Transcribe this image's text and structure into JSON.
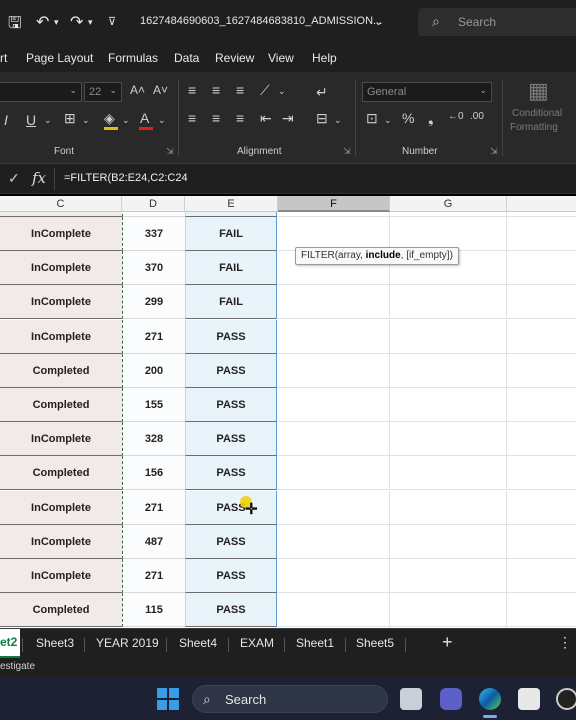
{
  "titlebar": {
    "filename": "1627484690603_1627484683810_ADMISSION...",
    "search_placeholder": "Search"
  },
  "menu_tabs": [
    "rt",
    "Page Layout",
    "Formulas",
    "Data",
    "Review",
    "View",
    "Help"
  ],
  "ribbon": {
    "font_size": "22",
    "number_format": "General",
    "conditional_formatting": [
      "Conditional",
      "Formatting"
    ],
    "groups": {
      "font": "Font",
      "alignment": "Alignment",
      "number": "Number"
    }
  },
  "formula_bar": {
    "fx": "fx",
    "formula": "=FILTER(B2:E24,C2:C24"
  },
  "columns": [
    "C",
    "D",
    "E",
    "F",
    "G"
  ],
  "rows": [
    {
      "status": "InComplete",
      "score": "337",
      "result": "FAIL"
    },
    {
      "status": "InComplete",
      "score": "370",
      "result": "FAIL"
    },
    {
      "status": "InComplete",
      "score": "299",
      "result": "FAIL"
    },
    {
      "status": "InComplete",
      "score": "271",
      "result": "PASS"
    },
    {
      "status": "Completed",
      "score": "200",
      "result": "PASS"
    },
    {
      "status": "Completed",
      "score": "155",
      "result": "PASS"
    },
    {
      "status": "InComplete",
      "score": "328",
      "result": "PASS"
    },
    {
      "status": "Completed",
      "score": "156",
      "result": "PASS"
    },
    {
      "status": "InComplete",
      "score": "271",
      "result": "PASS"
    },
    {
      "status": "InComplete",
      "score": "487",
      "result": "PASS"
    },
    {
      "status": "InComplete",
      "score": "271",
      "result": "PASS"
    },
    {
      "status": "Completed",
      "score": "115",
      "result": "PASS"
    }
  ],
  "tooltip": {
    "prefix": "FILTER(array, ",
    "bold": "include",
    "suffix": ", [if_empty])"
  },
  "sheet_tabs": {
    "active": "et2",
    "others": [
      "Sheet3",
      "YEAR 2019",
      "Sheet4",
      "EXAM",
      "Sheet1",
      "Sheet5"
    ],
    "add": "+"
  },
  "status_text": "estigate",
  "taskbar": {
    "search_label": "Search"
  },
  "colors": {
    "accent": "#107c41",
    "selected_col": "#5b9bd5"
  }
}
